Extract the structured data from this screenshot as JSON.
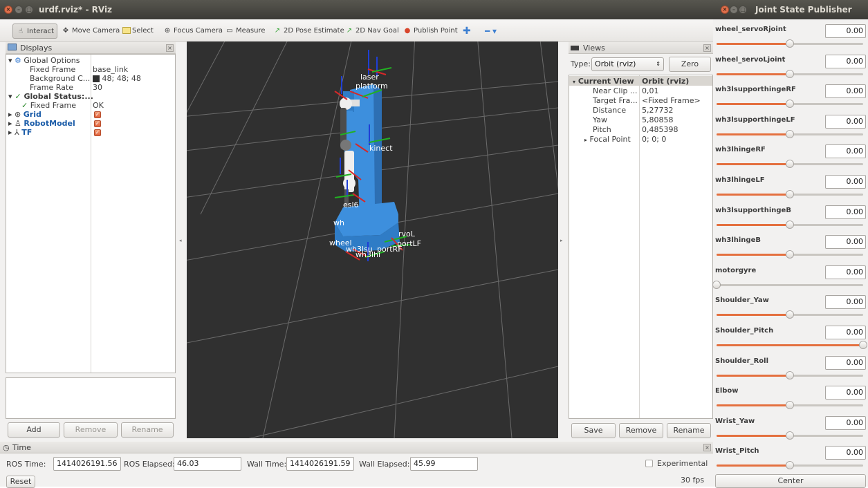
{
  "rviz": {
    "title": "urdf.rviz* - RViz",
    "toolbar": {
      "interact": "Interact",
      "move_camera": "Move Camera",
      "select": "Select",
      "focus_camera": "Focus Camera",
      "measure": "Measure",
      "pose_estimate": "2D Pose Estimate",
      "nav_goal": "2D Nav Goal",
      "publish_point": "Publish Point"
    },
    "displays": {
      "title": "Displays",
      "global_options": "Global Options",
      "fixed_frame_label": "Fixed Frame",
      "fixed_frame_value": "base_link",
      "background_label": "Background C...",
      "background_value": "48; 48; 48",
      "background_color": "#303030",
      "frame_rate_label": "Frame Rate",
      "frame_rate_value": "30",
      "global_status": "Global Status:...",
      "status_fixed_frame": "Fixed Frame",
      "status_value": "OK",
      "grid": "Grid",
      "robot_model": "RobotModel",
      "tf": "TF",
      "add": "Add",
      "remove": "Remove",
      "rename": "Rename"
    },
    "views": {
      "title": "Views",
      "type_label": "Type:",
      "type_value": "Orbit (rviz)",
      "zero": "Zero",
      "current_view": "Current View",
      "current_view_value": "Orbit (rviz)",
      "props": [
        {
          "name": "Near Clip ...",
          "value": "0,01"
        },
        {
          "name": "Target Fra...",
          "value": "<Fixed Frame>"
        },
        {
          "name": "Distance",
          "value": "5,27732"
        },
        {
          "name": "Yaw",
          "value": "5,80858"
        },
        {
          "name": "Pitch",
          "value": "0,485398"
        }
      ],
      "focal_point": "Focal Point",
      "focal_point_value": "0; 0; 0",
      "save": "Save",
      "remove": "Remove",
      "rename": "Rename"
    },
    "scene_labels": {
      "laser": "laser",
      "platform": "platform",
      "kinect": "kinect",
      "esl6": "esl6",
      "wh": "wh",
      "wheel": "wheel",
      "servo": "rvoL",
      "port": "portLF",
      "wh3ls": "wh3lsu",
      "port_rf": "portRF",
      "wh3lhi": "wh3lhi"
    },
    "time": {
      "title": "Time",
      "ros_time_label": "ROS Time:",
      "ros_time": "1414026191.56",
      "ros_elapsed_label": "ROS Elapsed:",
      "ros_elapsed": "46.03",
      "wall_time_label": "Wall Time:",
      "wall_time": "1414026191.59",
      "wall_elapsed_label": "Wall Elapsed:",
      "wall_elapsed": "45.99",
      "experimental": "Experimental",
      "reset": "Reset",
      "fps": "30 fps"
    }
  },
  "jsp": {
    "title": "Joint State Publisher",
    "joints": [
      {
        "name": "wheel_servoRjoint",
        "value": "0.00",
        "level": 0.5
      },
      {
        "name": "wheel_servoLjoint",
        "value": "0.00",
        "level": 0.5
      },
      {
        "name": "wh3lsupporthingeRF",
        "value": "0.00",
        "level": 0.5
      },
      {
        "name": "wh3lsupporthingeLF",
        "value": "0.00",
        "level": 0.5
      },
      {
        "name": "wh3lhingeRF",
        "value": "0.00",
        "level": 0.5
      },
      {
        "name": "wh3lhingeLF",
        "value": "0.00",
        "level": 0.5
      },
      {
        "name": "wh3lsupporthingeB",
        "value": "0.00",
        "level": 0.5
      },
      {
        "name": "wh3lhingeB",
        "value": "0.00",
        "level": 0.5
      },
      {
        "name": "motorgyre",
        "value": "0.00",
        "level": 0.0
      },
      {
        "name": "Shoulder_Yaw",
        "value": "0.00",
        "level": 0.5
      },
      {
        "name": "Shoulder_Pitch",
        "value": "0.00",
        "level": 1.0
      },
      {
        "name": "Shoulder_Roll",
        "value": "0.00",
        "level": 0.5
      },
      {
        "name": "Elbow",
        "value": "0.00",
        "level": 0.5
      },
      {
        "name": "Wrist_Yaw",
        "value": "0.00",
        "level": 0.5
      },
      {
        "name": "Wrist_Pitch",
        "value": "0.00",
        "level": 0.5
      }
    ],
    "center": "Center"
  }
}
